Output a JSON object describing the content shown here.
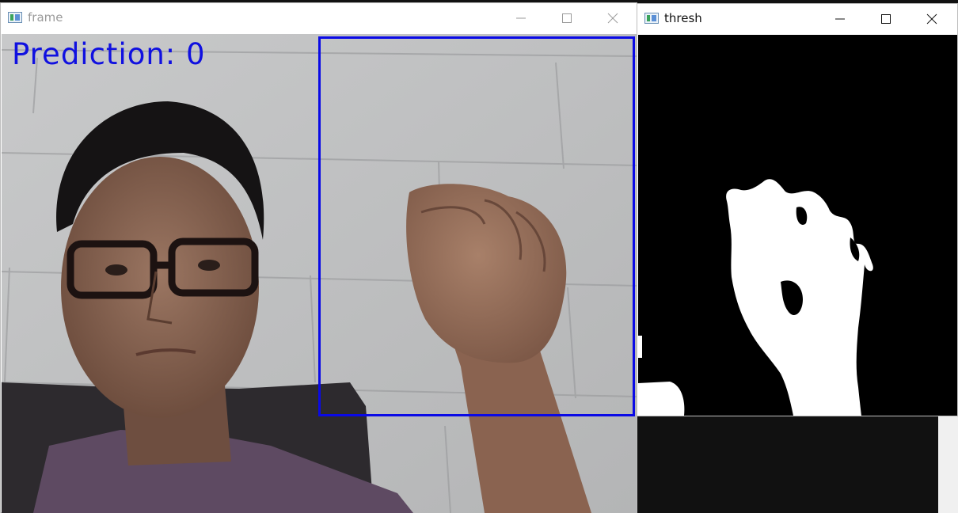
{
  "windows": {
    "frame": {
      "title": "frame",
      "overlay_text": "Prediction: 0"
    },
    "thresh": {
      "title": "thresh"
    }
  },
  "icons": {
    "app": "opencv-window-icon",
    "minimize": "minimize-icon",
    "maximize": "maximize-icon",
    "close": "close-icon"
  },
  "colors": {
    "overlay_text": "#1010e0",
    "roi_box": "#0a0ae6",
    "thresh_background": "#000000",
    "thresh_foreground": "#ffffff"
  }
}
